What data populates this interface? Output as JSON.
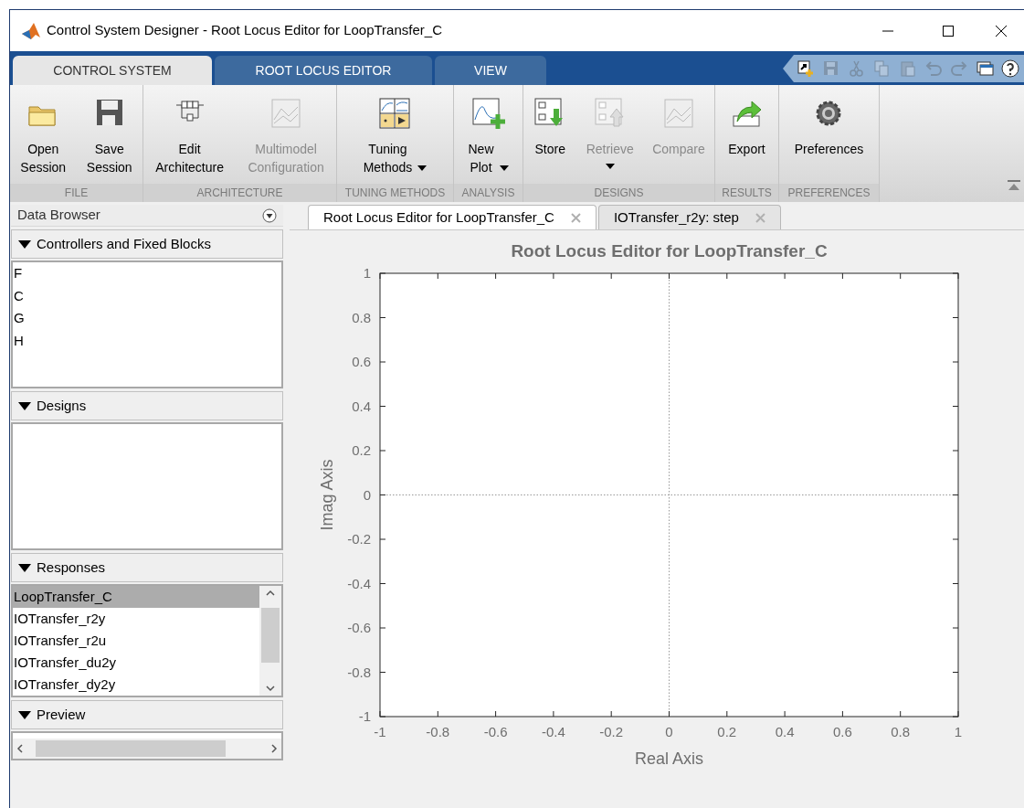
{
  "window": {
    "title": "Control System Designer - Root Locus Editor for LoopTransfer_C"
  },
  "ribbon_tabs": [
    {
      "label": "CONTROL SYSTEM",
      "selected": true
    },
    {
      "label": "ROOT LOCUS EDITOR",
      "selected": false
    },
    {
      "label": "VIEW",
      "selected": false
    }
  ],
  "quick_access": [
    {
      "kind": "new",
      "disabled": false
    },
    {
      "kind": "save",
      "disabled": true
    },
    {
      "kind": "cut",
      "disabled": true
    },
    {
      "kind": "copy",
      "disabled": true
    },
    {
      "kind": "paste",
      "disabled": true
    },
    {
      "kind": "undo",
      "disabled": true
    },
    {
      "kind": "redo",
      "disabled": true
    },
    {
      "kind": "window",
      "disabled": false
    },
    {
      "kind": "help",
      "disabled": false
    }
  ],
  "toolstrip": [
    {
      "section": "FILE",
      "buttons": [
        {
          "kind": "folder",
          "label": "Open\nSession",
          "disabled": false,
          "dropdown": false
        },
        {
          "kind": "save",
          "label": "Save\nSession",
          "disabled": false,
          "dropdown": false
        }
      ]
    },
    {
      "section": "ARCHITECTURE",
      "buttons": [
        {
          "kind": "blocks",
          "label": "Edit\nArchitecture",
          "disabled": false,
          "dropdown": false
        },
        {
          "kind": "plot",
          "label": "Multimodel\nConfiguration",
          "disabled": true,
          "dropdown": false
        }
      ]
    },
    {
      "section": "TUNING METHODS",
      "buttons": [
        {
          "kind": "tuning",
          "label": "Tuning\nMethods",
          "disabled": false,
          "dropdown": true
        }
      ]
    },
    {
      "section": "ANALYSIS",
      "buttons": [
        {
          "kind": "newplot",
          "label": "New\nPlot",
          "disabled": false,
          "dropdown": true
        }
      ]
    },
    {
      "section": "DESIGNS",
      "buttons": [
        {
          "kind": "store",
          "label": "Store",
          "disabled": false,
          "dropdown": false
        },
        {
          "kind": "retrieve",
          "label": "Retrieve",
          "disabled": true,
          "dropdown": true
        },
        {
          "kind": "plot",
          "label": "Compare",
          "disabled": true,
          "dropdown": false
        }
      ]
    },
    {
      "section": "RESULTS",
      "buttons": [
        {
          "kind": "export",
          "label": "Export",
          "disabled": false,
          "dropdown": false
        }
      ]
    },
    {
      "section": "PREFERENCES",
      "buttons": [
        {
          "kind": "gear",
          "label": "Preferences",
          "disabled": false,
          "dropdown": false
        }
      ]
    }
  ],
  "data_browser": {
    "title": "Data Browser",
    "sections": [
      {
        "title": "Controllers and Fixed Blocks",
        "expanded": true,
        "items": [
          {
            "label": "F",
            "selected": false
          },
          {
            "label": "C",
            "selected": false
          },
          {
            "label": "G",
            "selected": false
          },
          {
            "label": "H",
            "selected": false
          }
        ]
      },
      {
        "title": "Designs",
        "expanded": true
      },
      {
        "title": "Responses",
        "expanded": true,
        "items": [
          {
            "label": "LoopTransfer_C",
            "selected": true
          },
          {
            "label": "IOTransfer_r2y",
            "selected": false
          },
          {
            "label": "IOTransfer_r2u",
            "selected": false
          },
          {
            "label": "IOTransfer_du2y",
            "selected": false
          },
          {
            "label": "IOTransfer_dy2y",
            "selected": false
          }
        ]
      },
      {
        "title": "Preview",
        "expanded": true
      }
    ]
  },
  "document_tabs": [
    {
      "label": "Root Locus Editor for LoopTransfer_C",
      "selected": true
    },
    {
      "label": "IOTransfer_r2y: step",
      "selected": false
    }
  ],
  "plot": {
    "chart_data": {
      "type": "scatter",
      "title": "Root Locus Editor for LoopTransfer_C",
      "xlabel": "Real Axis",
      "ylabel": "Imag Axis",
      "xlim": [
        -1,
        1
      ],
      "ylim": [
        -1,
        1
      ],
      "xticks": [
        {
          "value": -1,
          "label": "-1"
        },
        {
          "value": -0.8,
          "label": "-0.8"
        },
        {
          "value": -0.6,
          "label": "-0.6"
        },
        {
          "value": -0.4,
          "label": "-0.4"
        },
        {
          "value": -0.2,
          "label": "-0.2"
        },
        {
          "value": 0,
          "label": "0"
        },
        {
          "value": 0.2,
          "label": "0.2"
        },
        {
          "value": 0.4,
          "label": "0.4"
        },
        {
          "value": 0.6,
          "label": "0.6"
        },
        {
          "value": 0.8,
          "label": "0.8"
        },
        {
          "value": 1,
          "label": "1"
        }
      ],
      "yticks": [
        {
          "value": -1,
          "label": "-1"
        },
        {
          "value": -0.8,
          "label": "-0.8"
        },
        {
          "value": -0.6,
          "label": "-0.6"
        },
        {
          "value": -0.4,
          "label": "-0.4"
        },
        {
          "value": -0.2,
          "label": "-0.2"
        },
        {
          "value": 0,
          "label": "0"
        },
        {
          "value": 0.2,
          "label": "0.2"
        },
        {
          "value": 0.4,
          "label": "0.4"
        },
        {
          "value": 0.6,
          "label": "0.6"
        },
        {
          "value": 0.8,
          "label": "0.8"
        },
        {
          "value": 1,
          "label": "1"
        }
      ]
    }
  }
}
